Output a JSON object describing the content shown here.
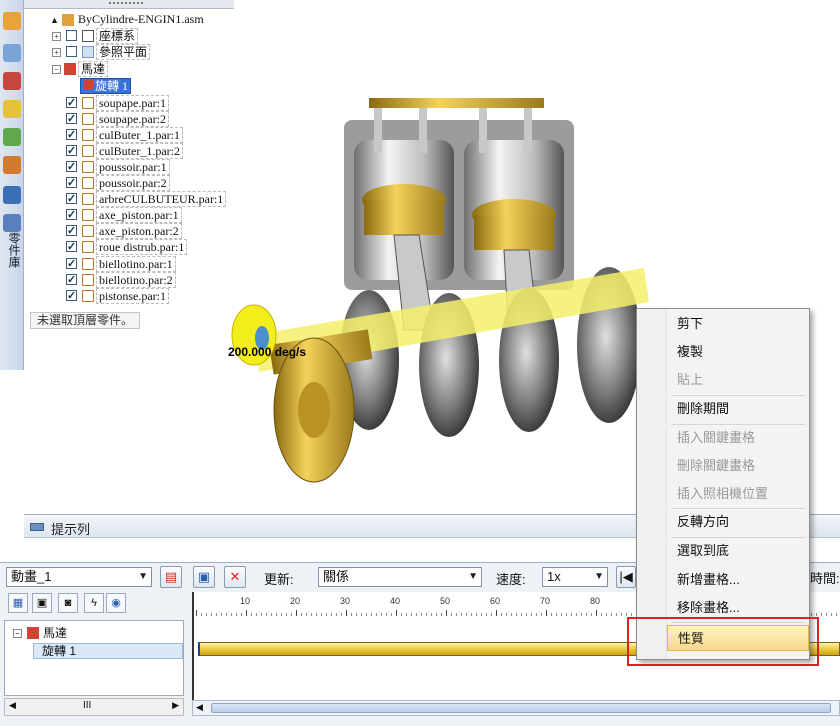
{
  "tree": {
    "assembly": "ByCylindre-ENGIN1.asm",
    "coord_systems": "座標系",
    "ref_planes": "參照平面",
    "motor": "馬達",
    "motor_child": "旋轉 1",
    "parts": [
      "soupape.par:1",
      "soupape.par:2",
      "culButer_1.par:1",
      "culButer_1.par:2",
      "poussoir.par:1",
      "poussoir.par:2",
      "arbreCULBUTEUR.par:1",
      "axe_piston.par:1",
      "axe_piston.par:2",
      "roue distrub.par:1",
      "biellotino.par:1",
      "biellotino.par:2",
      "pistonse.par:1"
    ],
    "status_tip": "未選取頂層零件。"
  },
  "left_toolbar": {
    "vertical_label": "零件庫"
  },
  "viewport": {
    "speed_label": "200.000 deg/s"
  },
  "prompt_bar": {
    "label": "提示列"
  },
  "animation_editor": {
    "animation_name": "動畫_1",
    "update_label": "更新:",
    "update_value": "關係",
    "speed_label": "速度:",
    "speed_value": "1x",
    "time_label": "時間:",
    "ruler_ticks": [
      "10",
      "20",
      "30",
      "40",
      "50",
      "60",
      "70",
      "80"
    ],
    "tree_root": "馬達",
    "tree_child": "旋轉 1",
    "scroll_thumb": "III"
  },
  "context_menu": {
    "items": [
      {
        "label": "剪下",
        "enabled": true
      },
      {
        "label": "複製",
        "enabled": true
      },
      {
        "label": "貼上",
        "enabled": false
      },
      {
        "label": "刪除期間",
        "enabled": true
      },
      {
        "label": "插入關鍵畫格",
        "enabled": false
      },
      {
        "label": "刪除關鍵畫格",
        "enabled": false
      },
      {
        "label": "插入照相機位置",
        "enabled": false
      },
      {
        "label": "反轉方向",
        "enabled": true
      },
      {
        "label": "選取到底",
        "enabled": true
      },
      {
        "label": "新增畫格...",
        "enabled": true
      },
      {
        "label": "移除畫格...",
        "enabled": true
      },
      {
        "label": "性質",
        "enabled": true,
        "highlighted": true
      }
    ]
  },
  "colors": {
    "highlight": "#f7d98a",
    "selection": "#3a74d8",
    "track_bar": "#e9c63c",
    "callout_box": "#e0201e"
  }
}
